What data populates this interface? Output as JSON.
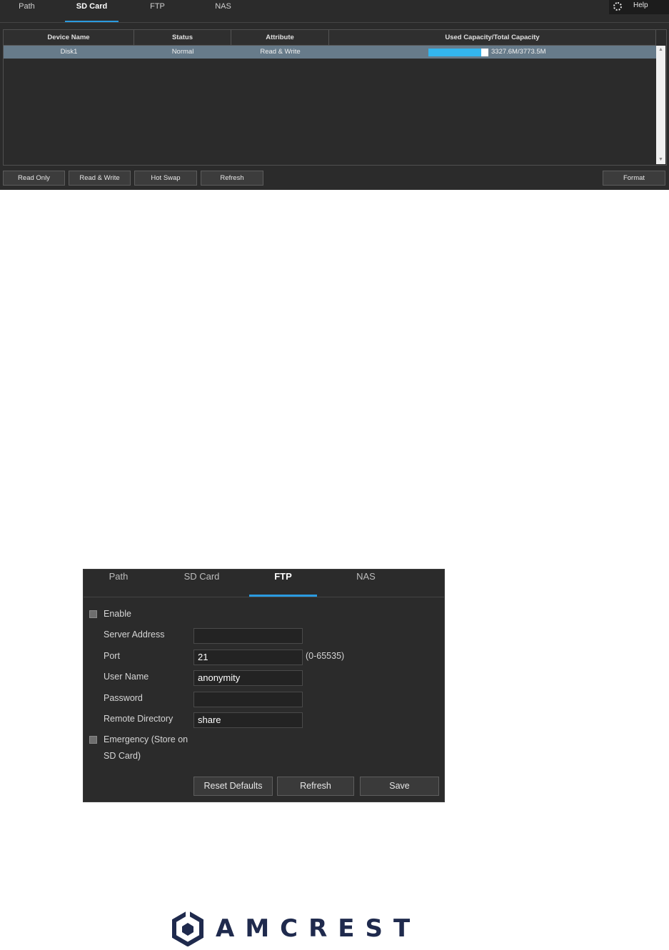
{
  "sd_panel": {
    "tabs": [
      "Path",
      "SD Card",
      "FTP",
      "NAS"
    ],
    "active_tab": "SD Card",
    "help_label": "Help",
    "table": {
      "headers": [
        "Device Name",
        "Status",
        "Attribute",
        "Used Capacity/Total Capacity"
      ],
      "rows": [
        {
          "device": "Disk1",
          "status": "Normal",
          "attribute": "Read & Write",
          "capacity": "3327.6M/3773.5M",
          "used_fraction": 0.882
        }
      ]
    },
    "buttons": {
      "read_only": "Read Only",
      "read_write": "Read & Write",
      "hot_swap": "Hot Swap",
      "refresh": "Refresh",
      "format": "Format"
    }
  },
  "ftp_panel": {
    "tabs": [
      "Path",
      "SD Card",
      "FTP",
      "NAS"
    ],
    "active_tab": "FTP",
    "enable_label": "Enable",
    "fields": {
      "server_address": {
        "label": "Server Address",
        "value": ""
      },
      "port": {
        "label": "Port",
        "value": "21",
        "hint": "(0-65535)"
      },
      "user_name": {
        "label": "User Name",
        "value": "anonymity"
      },
      "password": {
        "label": "Password",
        "value": ""
      },
      "remote_directory": {
        "label": "Remote Directory",
        "value": "share"
      }
    },
    "emergency_label_line1": "Emergency (Store on",
    "emergency_label_line2": "SD Card)",
    "buttons": {
      "reset_defaults": "Reset Defaults",
      "refresh": "Refresh",
      "save": "Save"
    }
  },
  "logo": {
    "text": "AMCREST",
    "color": "#1f2a4d"
  },
  "colors": {
    "accent": "#2a9be0",
    "capacity_fill": "#33b5ee",
    "selected_row": "#677b8a",
    "panel_bg": "#2b2b2b"
  }
}
